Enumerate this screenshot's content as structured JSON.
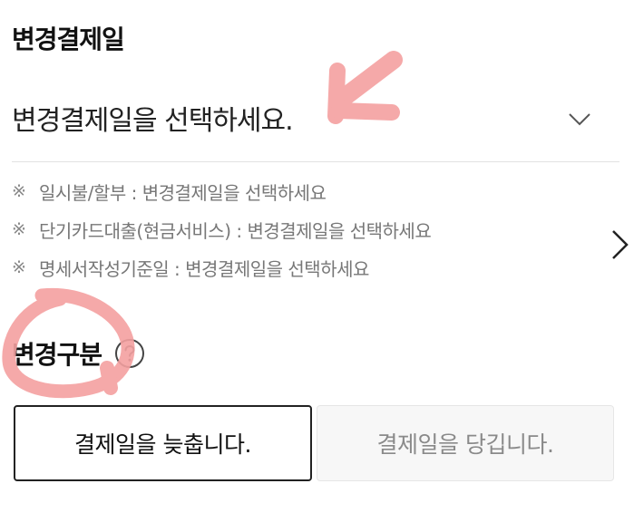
{
  "section": {
    "title": "변경결제일"
  },
  "dropdown": {
    "value": "변경결제일을 선택하세요."
  },
  "notes": {
    "mark": "※",
    "items": [
      "일시불/할부 : 변경결제일을 선택하세요",
      "단기카드대출(현금서비스) : 변경결제일을 선택하세요",
      "명세서작성기준일 : 변경결제일을 선택하세요"
    ]
  },
  "change_type": {
    "label": "변경구분",
    "options": [
      {
        "label": "결제일을 늦춥니다.",
        "selected": true
      },
      {
        "label": "결제일을 당깁니다.",
        "selected": false
      }
    ]
  },
  "icons": {
    "dropdown": "chevron-down-icon",
    "next": "chevron-right-icon",
    "help": "help-circle-icon"
  },
  "colors": {
    "annotation": "#f4a0a0",
    "selected_border": "#222222",
    "unselected_background": "#f7f7f7",
    "note_text": "#777777"
  }
}
